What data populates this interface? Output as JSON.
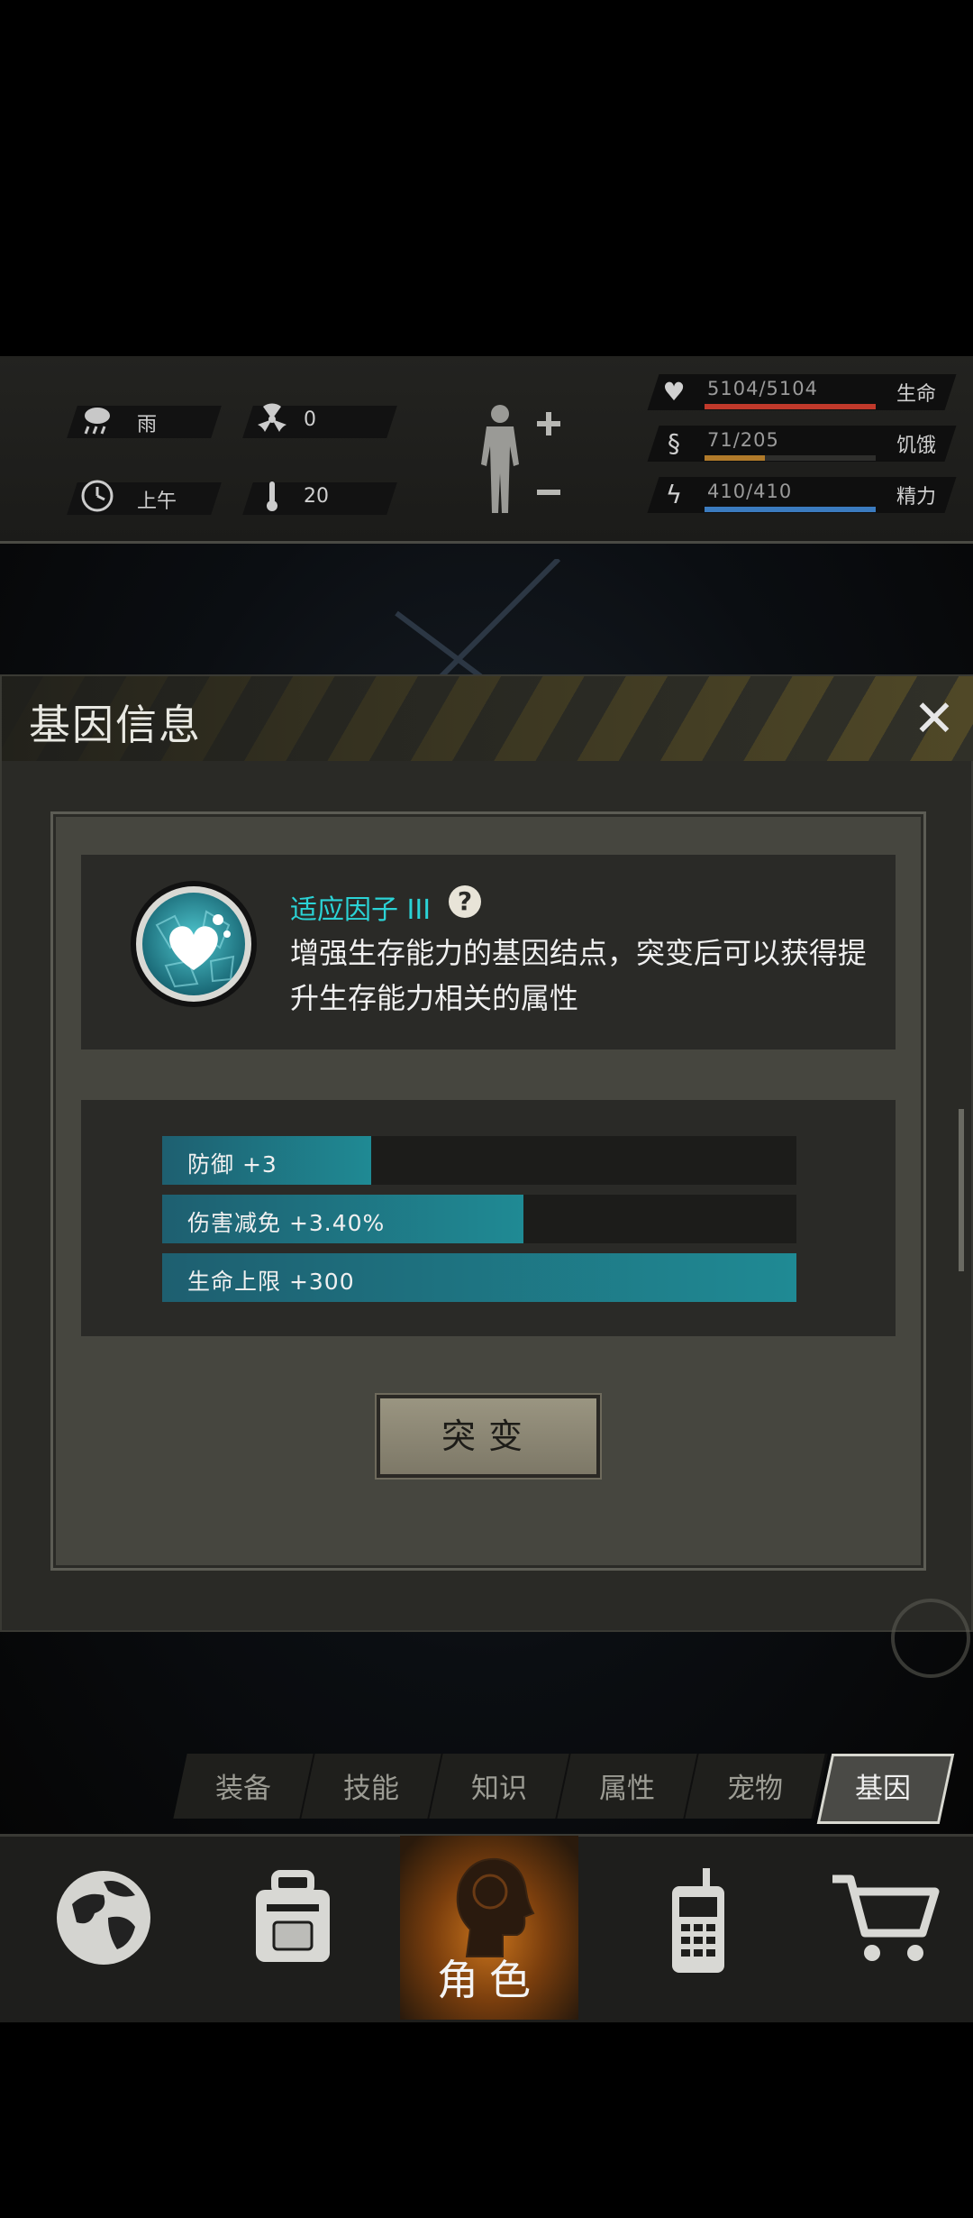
{
  "status": {
    "weather_label": "雨",
    "radiation_value": "0",
    "time_label": "上午",
    "temperature_value": "20",
    "bars": [
      {
        "value": "5104/5104",
        "label": "生命",
        "fraction": 1.0,
        "color": "#c0392b",
        "icon": "heart-icon"
      },
      {
        "value": "71/205",
        "label": "饥饿",
        "fraction": 0.35,
        "color": "#b07a2a",
        "icon": "stomach-icon"
      },
      {
        "value": "410/410",
        "label": "精力",
        "fraction": 1.0,
        "color": "#3b7bbf",
        "icon": "energy-icon"
      }
    ]
  },
  "dialog": {
    "title": "基因信息",
    "gene": {
      "name": "适应因子 III",
      "help_symbol": "?",
      "description": "增强生存能力的基因结点，突变后可以获得提升生存能力相关的属性"
    },
    "stats": [
      {
        "label": "防御 +3",
        "fraction": 0.33
      },
      {
        "label": "伤害减免 +3.40%",
        "fraction": 0.57
      },
      {
        "label": "生命上限 +300",
        "fraction": 1.0
      }
    ],
    "mutate_label": "突变"
  },
  "tabs": [
    {
      "label": "装备",
      "active": false
    },
    {
      "label": "技能",
      "active": false
    },
    {
      "label": "知识",
      "active": false
    },
    {
      "label": "属性",
      "active": false
    },
    {
      "label": "宠物",
      "active": false
    },
    {
      "label": "基因",
      "active": true
    }
  ],
  "nav": {
    "items": [
      {
        "name": "world",
        "icon": "globe-icon"
      },
      {
        "name": "backpack",
        "icon": "backpack-icon"
      },
      {
        "name": "role",
        "icon": "head-icon",
        "label": "角色",
        "active": true
      },
      {
        "name": "radio",
        "icon": "walkie-talkie-icon"
      },
      {
        "name": "shop",
        "icon": "cart-icon"
      }
    ]
  },
  "colors": {
    "accent_cyan": "#2bd3d6",
    "stat_fill": "#1f8a94",
    "role_glow": "#c8731c"
  }
}
